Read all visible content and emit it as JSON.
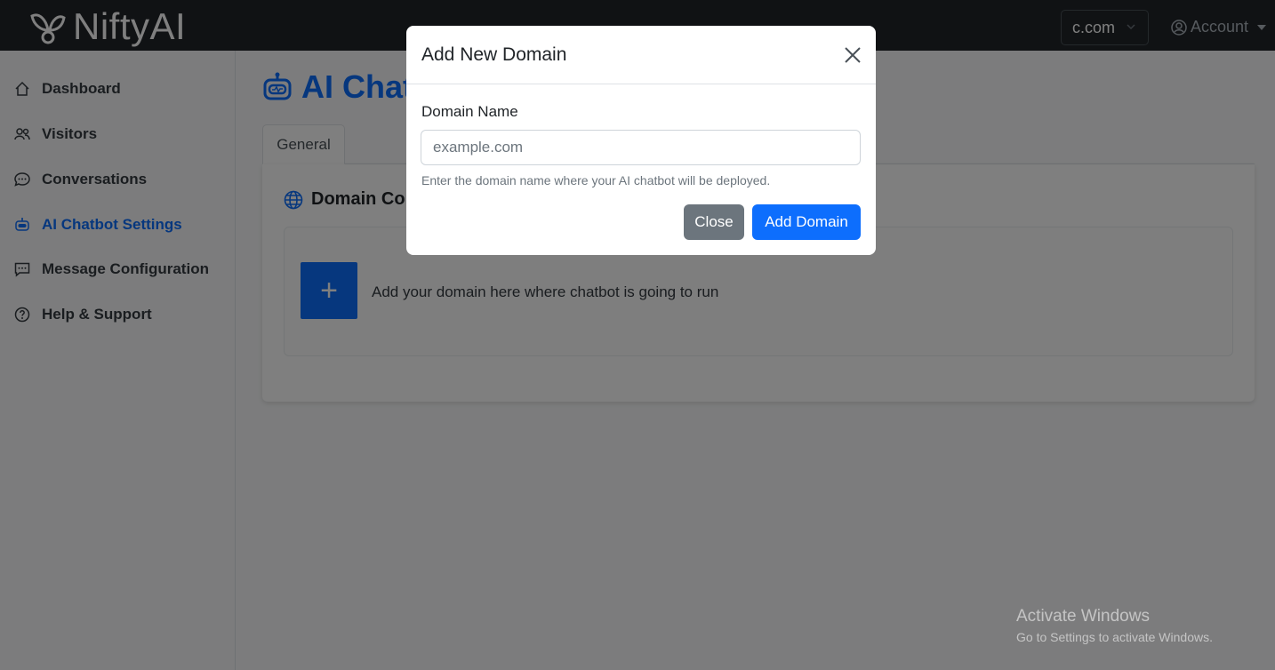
{
  "app": {
    "brand_name": "NiftyAI"
  },
  "navbar": {
    "domain_selected": "c.com",
    "account_label": "Account"
  },
  "sidebar": {
    "items": [
      {
        "label": "Dashboard",
        "icon": "home-icon"
      },
      {
        "label": "Visitors",
        "icon": "people-icon"
      },
      {
        "label": "Conversations",
        "icon": "chat-icon"
      },
      {
        "label": "AI Chatbot Settings",
        "icon": "robot-icon",
        "active": true
      },
      {
        "label": "Message Configuration",
        "icon": "message-dots-icon"
      },
      {
        "label": "Help & Support",
        "icon": "question-circle-icon"
      }
    ]
  },
  "main": {
    "title": "AI Chatb",
    "tabs": [
      {
        "label": "General"
      }
    ],
    "card": {
      "title": "Domain Co",
      "add_text": "Add your domain here where chatbot is going to run",
      "add_button_label": "+"
    }
  },
  "modal": {
    "title": "Add New Domain",
    "field_label": "Domain Name",
    "field_placeholder": "example.com",
    "field_value": "",
    "help_text": "Enter the domain name where your AI chatbot will be deployed.",
    "close_label": "Close",
    "submit_label": "Add Domain"
  },
  "watermark": {
    "title": "Activate Windows",
    "subtitle": "Go to Settings to activate Windows."
  },
  "colors": {
    "primary": "#0d6efd",
    "navbar_bg": "#212529",
    "secondary": "#6c757d"
  }
}
